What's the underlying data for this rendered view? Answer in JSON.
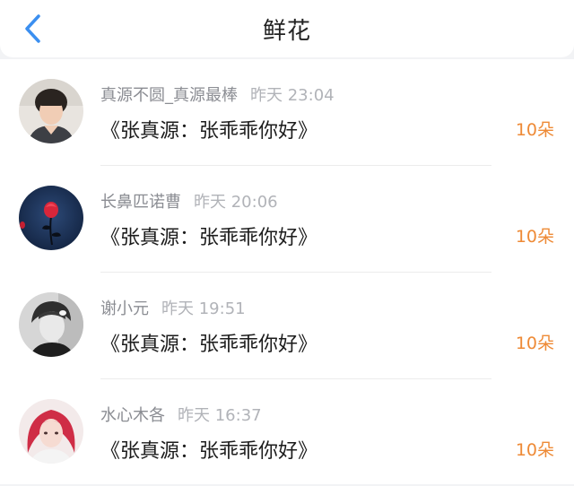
{
  "header": {
    "title": "鲜花",
    "back_icon": "chevron-left-icon",
    "accent_color": "#3b8ff0"
  },
  "list": {
    "items": [
      {
        "user": "真源不圆_真源最棒",
        "time": "昨天 23:04",
        "gift": "《张真源：张乖乖你好》",
        "count": "10朵",
        "avatar_icon": "avatar-boy-photo"
      },
      {
        "user": "长鼻匹诺曹",
        "time": "昨天 20:06",
        "gift": "《张真源：张乖乖你好》",
        "count": "10朵",
        "avatar_icon": "avatar-red-rose"
      },
      {
        "user": "谢小元",
        "time": "昨天 19:51",
        "gift": "《张真源：张乖乖你好》",
        "count": "10朵",
        "avatar_icon": "avatar-grayscale-portrait"
      },
      {
        "user": "水心木各",
        "time": "昨天 16:37",
        "gift": "《张真源：张乖乖你好》",
        "count": "10朵",
        "avatar_icon": "avatar-red-hair-portrait"
      }
    ]
  },
  "colors": {
    "count": "#ee8a36",
    "username": "#8b8d93",
    "time": "#b1b3b8"
  }
}
